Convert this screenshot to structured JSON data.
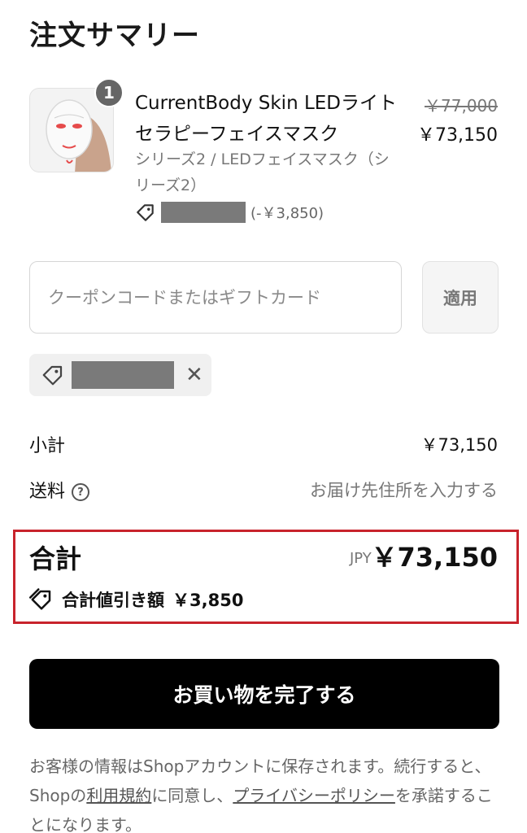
{
  "page_title": "注文サマリー",
  "product": {
    "quantity": "1",
    "name": "CurrentBody Skin LEDライトセラピーフェイスマスク",
    "variant": "シリーズ2 / LEDフェイスマスク（シリーズ2）",
    "original_price": "￥77,000",
    "price": "￥73,150",
    "discount_amount": "(-￥3,850)"
  },
  "coupon": {
    "placeholder": "クーポンコードまたはギフトカード",
    "apply_label": "適用"
  },
  "summary": {
    "subtotal_label": "小計",
    "subtotal_value": "￥73,150",
    "shipping_label": "送料",
    "shipping_value": "お届け先住所を入力する"
  },
  "total": {
    "label": "合計",
    "currency": "JPY",
    "value": "￥73,150",
    "savings_label": "合計値引き額",
    "savings_value": "￥3,850"
  },
  "checkout": {
    "button_label": "お買い物を完了する"
  },
  "legal": {
    "text_1": "お客様の情報はShopアカウントに保存されます。続行すると、Shopの",
    "terms_link": "利用規約",
    "text_2": "に同意し、",
    "privacy_link": "プライバシーポリシー",
    "text_3": "を承諾することになります。"
  },
  "colors": {
    "highlight_border": "#c8232c",
    "checkout_button": "#000000"
  },
  "icons": [
    "tag-icon",
    "close-icon",
    "help-icon",
    "discount-tag-icon",
    "face-mask-image"
  ]
}
